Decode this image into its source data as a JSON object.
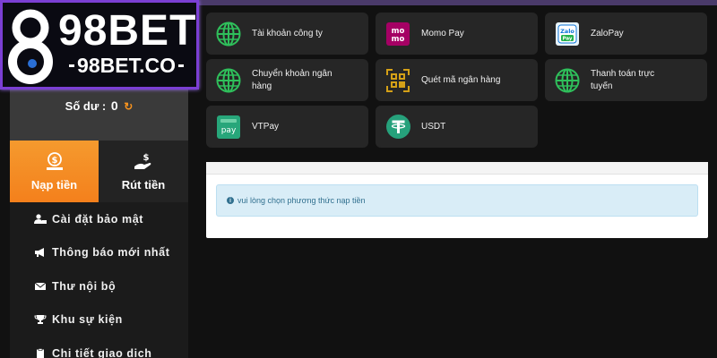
{
  "brand": {
    "title": "98BET",
    "subtitle": "98BET.CO"
  },
  "balance": {
    "label": "Số dư :",
    "value": "0"
  },
  "tabs": [
    {
      "label": "Nạp tiền",
      "icon": "money-bag-icon",
      "active": true
    },
    {
      "label": "Rút tiền",
      "icon": "hand-money-icon",
      "active": false
    }
  ],
  "menu": [
    {
      "label": "Cài đặt bảo mật",
      "icon": "user-lock-icon"
    },
    {
      "label": "Thông báo mới nhất",
      "icon": "megaphone-icon"
    },
    {
      "label": "Thư nội bộ",
      "icon": "envelope-icon"
    },
    {
      "label": "Khu sự kiện",
      "icon": "trophy-icon"
    },
    {
      "label": "Chi tiết giao dịch",
      "icon": "clipboard-icon"
    }
  ],
  "payments": [
    {
      "label": "Tài khoản công ty",
      "icon": "globe-icon"
    },
    {
      "label": "Momo Pay",
      "icon": "momo-icon"
    },
    {
      "label": "ZaloPay",
      "icon": "zalopay-icon"
    },
    {
      "label": "Chuyển khoản ngân hàng",
      "icon": "globe-icon"
    },
    {
      "label": "Quét mã ngân hàng",
      "icon": "qr-code-icon"
    },
    {
      "label": "Thanh toán trực tuyến",
      "icon": "globe-icon"
    },
    {
      "label": "VTPay",
      "icon": "vtpay-icon"
    },
    {
      "label": "USDT",
      "icon": "tether-icon"
    }
  ],
  "notice": {
    "text": "vui lòng chọn phương thức nạp tiền"
  },
  "colors": {
    "accent": "#f4801c",
    "globe": "#2fbf5b",
    "notice_bg": "#d9edf7",
    "notice_text": "#31708f",
    "logo_border": "#7b3fd4"
  }
}
